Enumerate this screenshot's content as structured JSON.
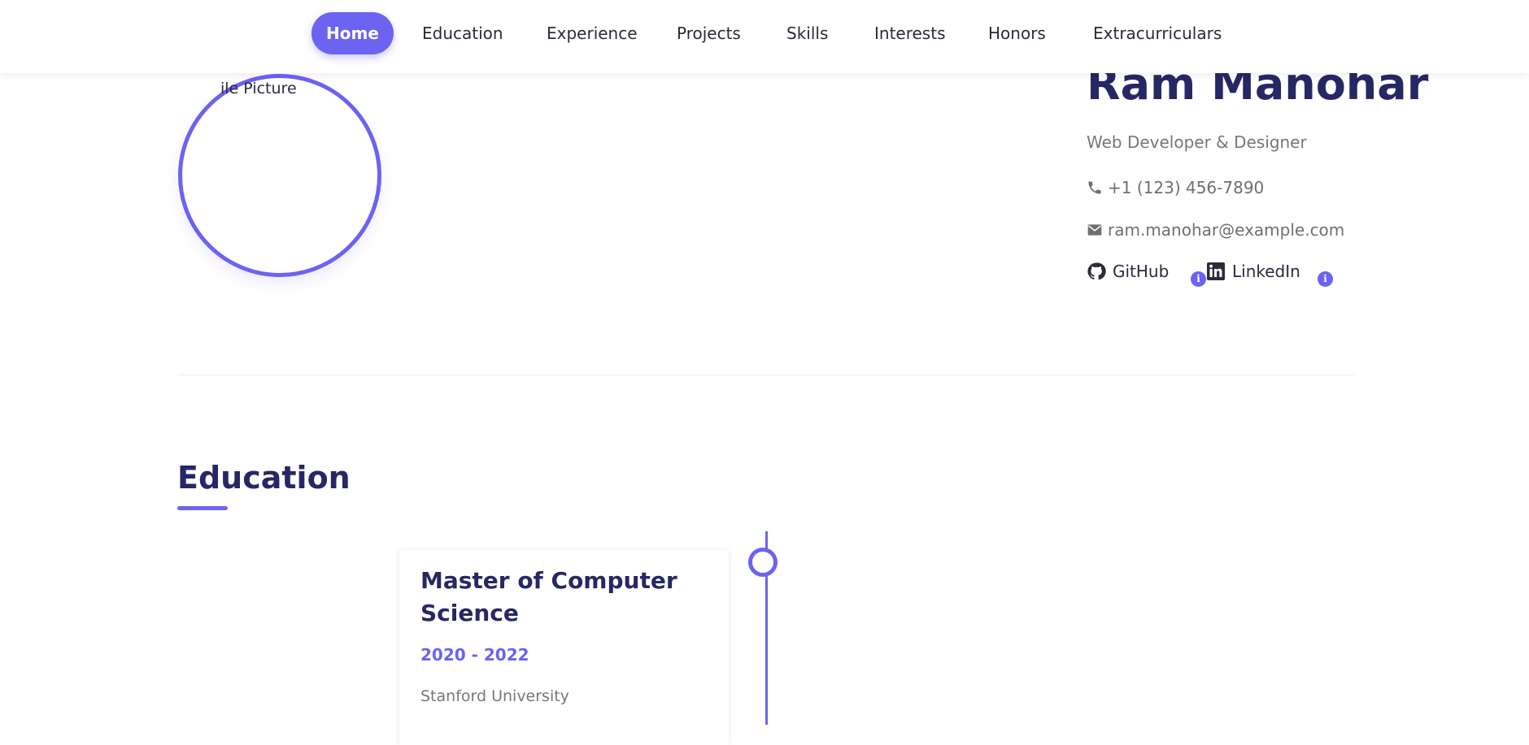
{
  "nav": {
    "items": [
      {
        "label": "Home",
        "active": true
      },
      {
        "label": "Education",
        "active": false
      },
      {
        "label": "Experience",
        "active": false
      },
      {
        "label": "Projects",
        "active": false
      },
      {
        "label": "Skills",
        "active": false
      },
      {
        "label": "Interests",
        "active": false
      },
      {
        "label": "Honors",
        "active": false
      },
      {
        "label": "Extracurriculars",
        "active": false
      }
    ]
  },
  "hero": {
    "profile_alt": "ile Picture",
    "name": "Ram Manohar",
    "subtitle": "Web Developer & Designer",
    "phone": "+1 (123) 456-7890",
    "email": "ram.manohar@example.com",
    "social": [
      {
        "label": "GitHub",
        "icon": "github-icon"
      },
      {
        "label": "LinkedIn",
        "icon": "linkedin-icon"
      }
    ],
    "info_badge": "i"
  },
  "education": {
    "title": "Education",
    "entries": [
      {
        "degree": "Master of Computer Science",
        "years": "2020 - 2022",
        "school": "Stanford University"
      }
    ]
  },
  "colors": {
    "accent": "#6c63f0",
    "heading": "#262764",
    "muted": "#777777"
  }
}
